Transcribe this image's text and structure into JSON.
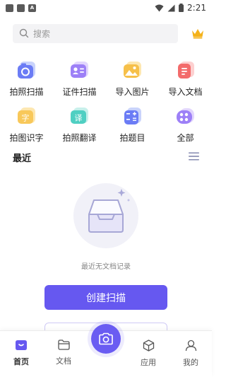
{
  "status_bar": {
    "time": "2:21",
    "a_label": "A"
  },
  "search": {
    "placeholder": "搜索"
  },
  "tools": [
    {
      "label": "拍照扫描",
      "icon": "camera-scan-icon",
      "color": "#6b8cf5"
    },
    {
      "label": "证件扫描",
      "icon": "id-card-icon",
      "color": "#a78bfa"
    },
    {
      "label": "导入图片",
      "icon": "image-import-icon",
      "color": "#f8c146"
    },
    {
      "label": "导入文档",
      "icon": "document-import-icon",
      "color": "#f57a7a"
    },
    {
      "label": "拍图识字",
      "icon": "ocr-text-icon",
      "color": "#f8c146",
      "glyph": "字"
    },
    {
      "label": "拍照翻译",
      "icon": "translate-icon",
      "color": "#4fd1c5",
      "glyph": "译"
    },
    {
      "label": "拍题目",
      "icon": "question-calc-icon",
      "color": "#6b8cf5"
    },
    {
      "label": "全部",
      "icon": "all-apps-icon",
      "color": "#a78bfa"
    }
  ],
  "recent": {
    "title": "最近"
  },
  "empty": {
    "text": "最近无文档记录"
  },
  "buttons": {
    "create_scan": "创建扫描"
  },
  "nav": {
    "home": "首页",
    "docs": "文档",
    "apps": "应用",
    "mine": "我的"
  },
  "colors": {
    "accent": "#6658f0"
  }
}
